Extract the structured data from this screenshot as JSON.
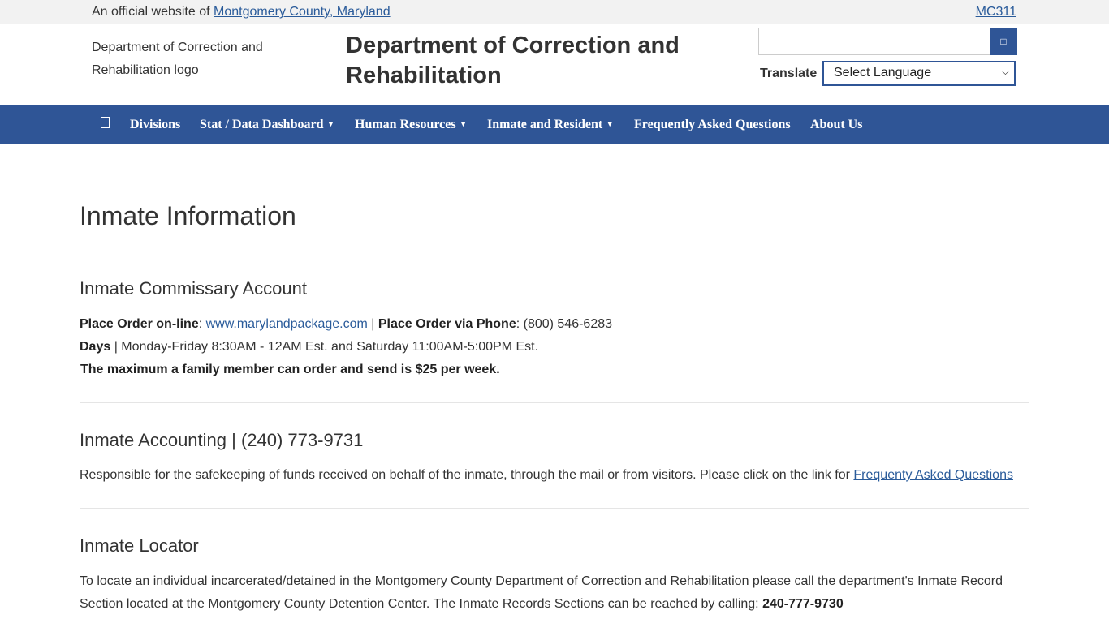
{
  "topbar": {
    "official_prefix": "An official website of",
    "county_link": "Montgomery County, Maryland",
    "mc311": "MC311"
  },
  "header": {
    "logo_alt": "Department of Correction and Rehabilitation logo",
    "title": "Department of Correction and Rehabilitation",
    "search_placeholder": "",
    "search_icon": "search-icon",
    "translate_label": "Translate",
    "language_selected": "Select Language"
  },
  "nav": {
    "home_icon": "home-icon",
    "items": [
      {
        "label": "Divisions",
        "dropdown": false
      },
      {
        "label": "Stat / Data Dashboard",
        "dropdown": true
      },
      {
        "label": "Human Resources",
        "dropdown": true
      },
      {
        "label": "Inmate and Resident",
        "dropdown": true
      },
      {
        "label": "Frequently Asked Questions",
        "dropdown": false
      },
      {
        "label": "About Us",
        "dropdown": false
      }
    ]
  },
  "main": {
    "page_title": "Inmate Information",
    "commissary": {
      "title": "Inmate Commissary Account",
      "order_online_label": "Place Order on-line",
      "order_online_link": "www.marylandpackage.com",
      "order_phone_label": "Place Order via Phone",
      "order_phone_value": ": (800) 546-6283",
      "days_label": "Days",
      "days_value": " | Monday-Friday 8:30AM - 12AM Est. and Saturday 11:00AM-5:00PM Est.",
      "max_note": "The maximum a family member can order and send is $25 per week."
    },
    "accounting": {
      "title": "Inmate Accounting | (240) 773-9731",
      "text": "Responsible for the safekeeping of funds received on behalf of the inmate, through the mail or from visitors. Please click on the link for ",
      "faq_link": "Frequenty Asked Questions"
    },
    "locator": {
      "title": "Inmate Locator",
      "text": "To locate an individual incarcerated/detained in the Montgomery County Department of Correction and Rehabilitation please call the department's Inmate Record Section located at the Montgomery County Detention Center. The Inmate Records Sections can be reached by calling: ",
      "phone": "240-777-9730"
    }
  },
  "colors": {
    "nav_bg": "#2f5596",
    "topbar_bg": "#f2f2f2",
    "link": "#2a5b9a"
  }
}
